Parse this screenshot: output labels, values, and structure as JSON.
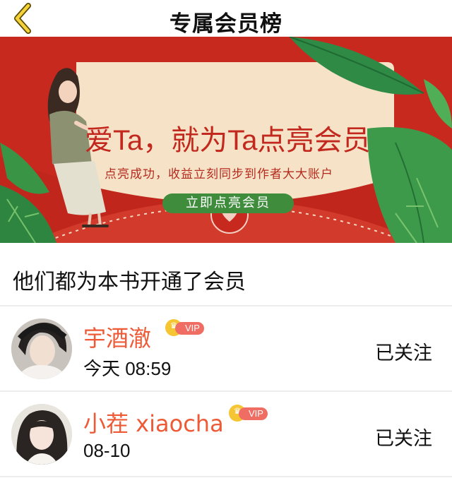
{
  "header": {
    "title": "专属会员榜",
    "back_icon": "back-chevron-icon"
  },
  "banner": {
    "headline": "爱Ta，就为Ta点亮会员",
    "subtitle": "点亮成功，收益立刻同步到作者大大账户",
    "cta_label": "立即点亮会员",
    "colors": {
      "background": "#c8291f",
      "card": "#f6e3c7",
      "cta": "#3f8d3c"
    }
  },
  "section": {
    "title": "他们都为本书开通了会员"
  },
  "members": [
    {
      "name": "宇酒澈",
      "badge": "VIP",
      "time": "今天 08:59",
      "follow_label": "已关注"
    },
    {
      "name": "小茬 xiaocha",
      "badge": "VIP",
      "time": "08-10",
      "follow_label": "已关注"
    }
  ],
  "colors": {
    "name": "#ee5a36",
    "vip": "#ef6d62",
    "crown": "#f6c534"
  }
}
